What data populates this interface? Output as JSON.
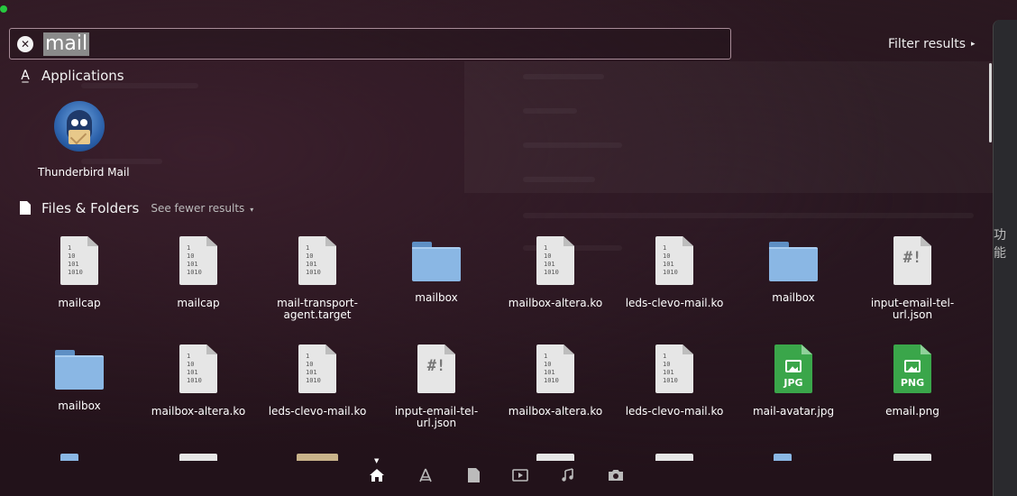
{
  "search": {
    "query": "mail"
  },
  "filter": {
    "label": "Filter results"
  },
  "applications": {
    "heading": "Applications",
    "items": [
      {
        "label": "Thunderbird Mail",
        "icon": "thunderbird-icon"
      }
    ]
  },
  "files": {
    "heading": "Files & Folders",
    "see_fewer": "See fewer results",
    "items": [
      {
        "label": "mailcap",
        "kind": "binary"
      },
      {
        "label": "mailcap",
        "kind": "binary"
      },
      {
        "label": "mail-transport-agent.target",
        "kind": "binary"
      },
      {
        "label": "mailbox",
        "kind": "folder"
      },
      {
        "label": "mailbox-altera.ko",
        "kind": "binary"
      },
      {
        "label": "leds-clevo-mail.ko",
        "kind": "binary"
      },
      {
        "label": "mailbox",
        "kind": "folder"
      },
      {
        "label": "input-email-tel-url.json",
        "kind": "script"
      },
      {
        "label": "mailbox",
        "kind": "folder"
      },
      {
        "label": "mailbox-altera.ko",
        "kind": "binary"
      },
      {
        "label": "leds-clevo-mail.ko",
        "kind": "binary"
      },
      {
        "label": "input-email-tel-url.json",
        "kind": "script"
      },
      {
        "label": "mailbox-altera.ko",
        "kind": "binary"
      },
      {
        "label": "leds-clevo-mail.ko",
        "kind": "binary"
      },
      {
        "label": "mail-avatar.jpg",
        "kind": "image",
        "ext": "JPG"
      },
      {
        "label": "email.png",
        "kind": "image",
        "ext": "PNG"
      }
    ]
  },
  "icon_text": {
    "binary": "1\n10\n101\n1010",
    "script": "#!"
  },
  "right_strip": {
    "text": "功能"
  },
  "dock": {
    "items": [
      "home-icon",
      "applications-icon",
      "files-icon",
      "videos-icon",
      "music-icon",
      "photos-icon"
    ]
  },
  "colors": {
    "folder": "#8ab7e4",
    "image_file": "#3aa64a",
    "window_dot": "#27c93f"
  }
}
